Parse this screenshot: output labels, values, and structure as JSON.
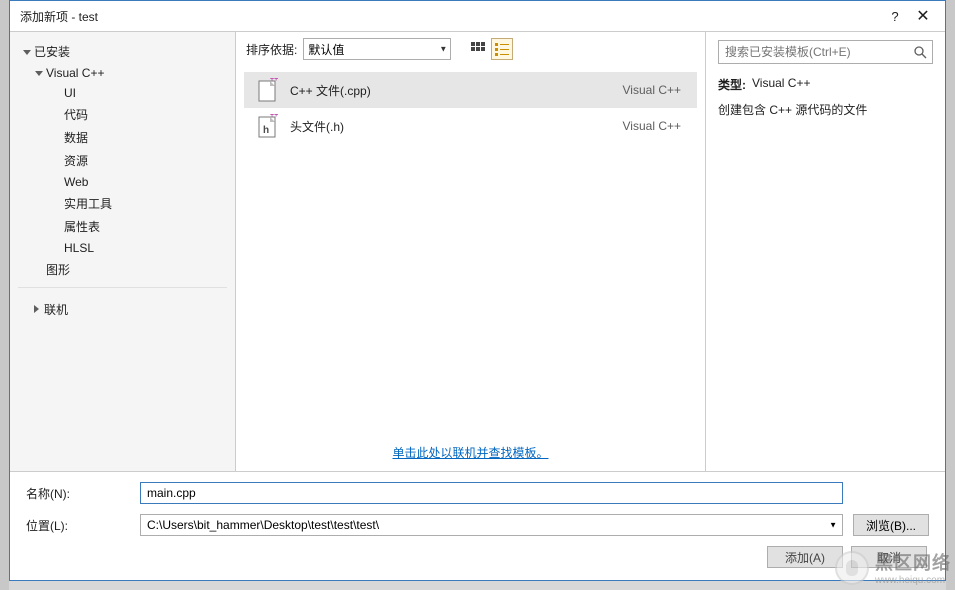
{
  "title": "添加新项 - test",
  "titlebar": {
    "help": "?",
    "close": "✕"
  },
  "tree": {
    "installed": "已安装",
    "vcpp": "Visual C++",
    "items": [
      "UI",
      "代码",
      "数据",
      "资源",
      "Web",
      "实用工具",
      "属性表",
      "HLSL"
    ],
    "graphics": "图形",
    "online": "联机"
  },
  "toolbar": {
    "sort_label": "排序依据:",
    "sort_value": "默认值"
  },
  "templates": [
    {
      "label": "C++ 文件(.cpp)",
      "lang": "Visual C++",
      "icon": "cpp"
    },
    {
      "label": "头文件(.h)",
      "lang": "Visual C++",
      "icon": "h"
    }
  ],
  "online_link": "单击此处以联机并查找模板。",
  "details": {
    "type_label": "类型:",
    "type_value": "Visual C++",
    "desc": "创建包含 C++ 源代码的文件"
  },
  "search": {
    "placeholder": "搜索已安装模板(Ctrl+E)"
  },
  "form": {
    "name_label": "名称(N):",
    "name_value": "main.cpp",
    "loc_label": "位置(L):",
    "loc_value": "C:\\Users\\bit_hammer\\Desktop\\test\\test\\test\\",
    "browse": "浏览(B)...",
    "add": "添加(A)",
    "cancel": "取消"
  },
  "watermark": {
    "brand": "黑区网络",
    "url": "www.heiqu.com"
  }
}
